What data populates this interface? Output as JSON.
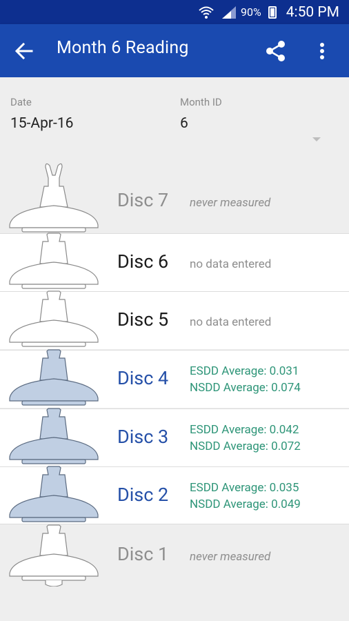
{
  "status_bar": {
    "battery": "90%",
    "time": "4:50 PM"
  },
  "app_bar": {
    "title": "Month 6 Reading"
  },
  "form": {
    "date_label": "Date",
    "date_value": "15-Apr-16",
    "month_label": "Month ID",
    "month_value": "6"
  },
  "discs": [
    {
      "name": "Disc 7",
      "status": "never measured"
    },
    {
      "name": "Disc 6",
      "status": "no data entered"
    },
    {
      "name": "Disc 5",
      "status": "no data entered"
    },
    {
      "name": "Disc 4",
      "esdd": "ESDD Average: 0.031",
      "nsdd": "NSDD Average: 0.074"
    },
    {
      "name": "Disc 3",
      "esdd": "ESDD Average: 0.042",
      "nsdd": "NSDD Average: 0.072"
    },
    {
      "name": "Disc 2",
      "esdd": "ESDD Average: 0.035",
      "nsdd": "NSDD Average: 0.049"
    },
    {
      "name": "Disc 1",
      "status": "never measured"
    }
  ],
  "colors": {
    "app_bar": "#1a4ab0",
    "status_bar": "#0d2f8f",
    "measured_text": "#2550a8",
    "average_text": "#2e9578",
    "measured_fill": "#c0cfe3"
  }
}
